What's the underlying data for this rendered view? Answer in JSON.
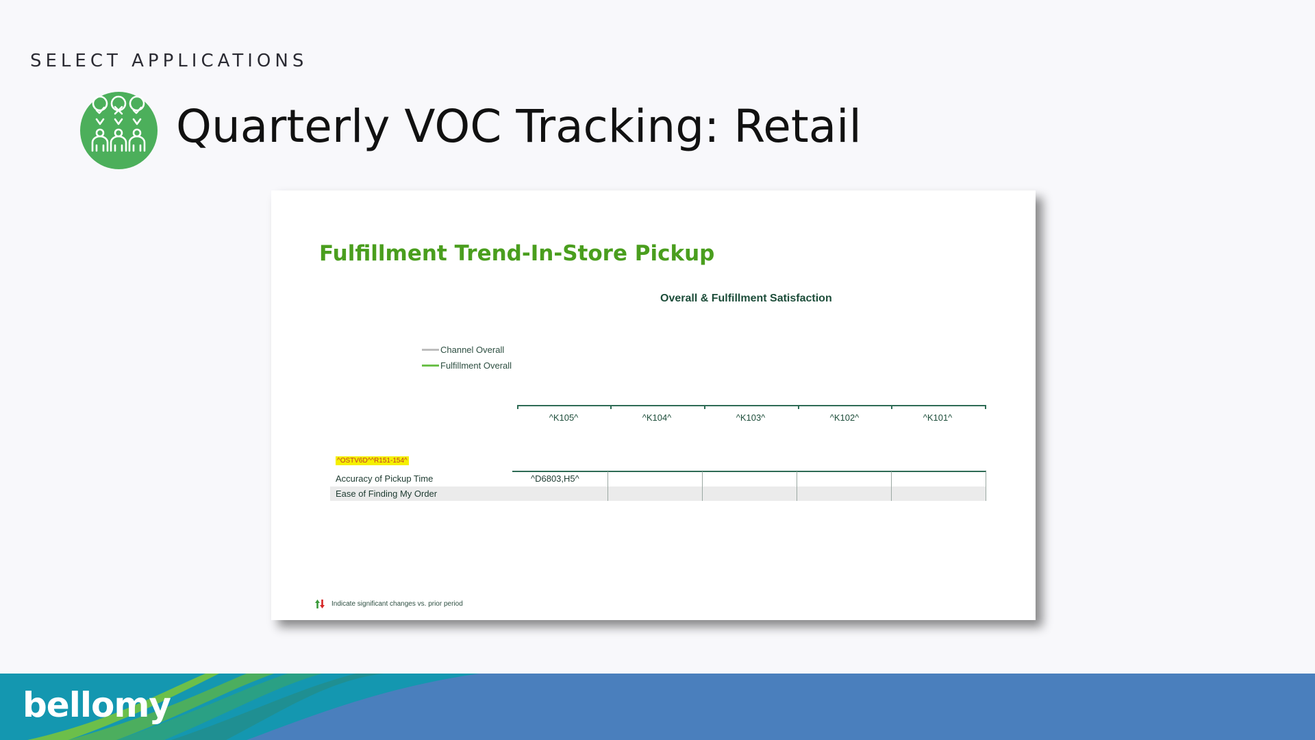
{
  "header": {
    "eyebrow": "SELECT APPLICATIONS",
    "title": "Quarterly VOC Tracking: Retail",
    "icon": "voting-people-icon",
    "icon_color": "#4caf5b"
  },
  "slide": {
    "title": "Fulfillment Trend-In-Store Pickup",
    "title_color": "#4a9e1e",
    "chart_title": "Overall & Fulfillment Satisfaction",
    "legend": [
      {
        "label": "Channel Overall",
        "color": "#bdbdbd"
      },
      {
        "label": "Fulfillment Overall",
        "color": "#6cc04a"
      }
    ],
    "axis_labels": [
      "^K105^",
      "^K104^",
      "^K103^",
      "^K102^",
      "^K101^"
    ],
    "code_tag": "^OSTV6D^^R151-154^",
    "rows": [
      {
        "label": "Accuracy of Pickup Time",
        "value": "^D6803,H5^"
      },
      {
        "label": "Ease of Finding My Order",
        "value": ""
      }
    ],
    "footnote": "Indicate significant changes vs. prior period",
    "footnote_icons": [
      "arrow-up-green-icon",
      "arrow-down-red-icon"
    ]
  },
  "footer": {
    "logo": "bellomy",
    "band_color": "#4a7fbd"
  }
}
